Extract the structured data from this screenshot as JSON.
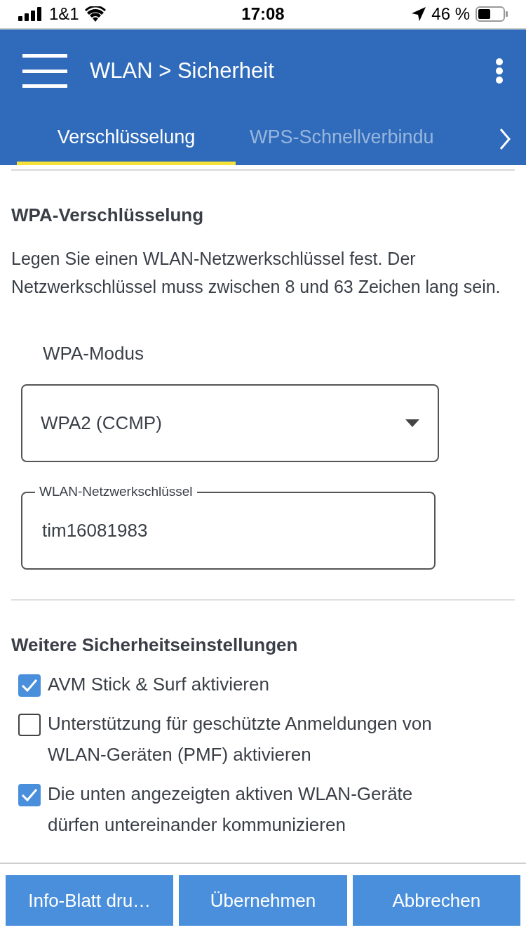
{
  "status_bar": {
    "carrier": "1&1",
    "time": "17:08",
    "battery": "46 %"
  },
  "header": {
    "title": "WLAN > Sicherheit"
  },
  "tabs": [
    {
      "label": "Verschlüsselung",
      "selected": true
    },
    {
      "label": "WPS-Schnellverbindu",
      "selected": false
    }
  ],
  "encryption": {
    "heading": "WPA-Verschlüsselung",
    "description": "Legen Sie einen WLAN-Netzwerkschlüssel fest. Der Netzwerkschlüssel muss zwischen 8 und 63 Zeichen lang sein.",
    "mode_label": "WPA-Modus",
    "mode_value": "WPA2 (CCMP)",
    "key_label": "WLAN-Netzwerkschlüssel",
    "key_value": "tim16081983"
  },
  "security": {
    "heading": "Weitere Sicherheitseinstellungen",
    "options": [
      {
        "label": "AVM Stick & Surf aktivieren",
        "checked": true
      },
      {
        "label": "Unterstützung für geschützte Anmeldungen von WLAN-Geräten (PMF) aktivieren",
        "checked": false
      },
      {
        "label": "Die unten angezeigten aktiven WLAN-Geräte dürfen untereinander kommunizieren",
        "checked": true
      }
    ]
  },
  "buttons": [
    "Info-Blatt dru…",
    "Übernehmen",
    "Abbrechen"
  ]
}
